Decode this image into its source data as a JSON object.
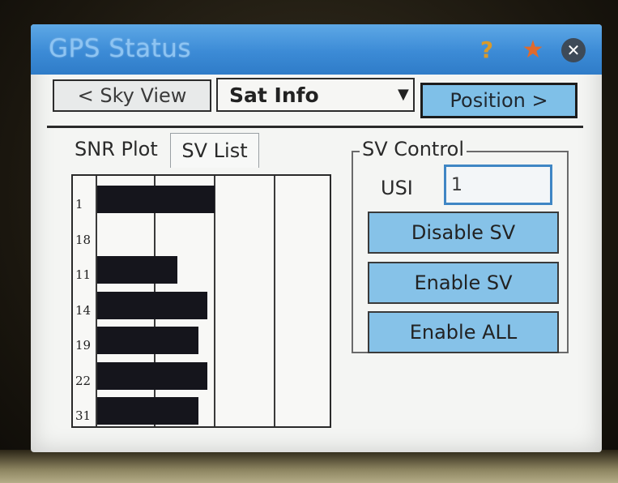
{
  "window": {
    "title": "GPS Status",
    "help_glyph": "?",
    "star_glyph": "★",
    "close_glyph": "✕"
  },
  "toolbar": {
    "back_label": "< Sky View",
    "view_select": {
      "selected": "Sat Info",
      "arrow": "▼"
    },
    "forward_label": "Position >"
  },
  "tabs": [
    {
      "label": "SNR Plot",
      "active": false
    },
    {
      "label": "SV List",
      "active": true
    }
  ],
  "snr_plot": {
    "rows": [
      {
        "sv": "1",
        "snr_fraction": 0.5
      },
      {
        "sv": "18",
        "snr_fraction": 0.0
      },
      {
        "sv": "11",
        "snr_fraction": 0.34
      },
      {
        "sv": "14",
        "snr_fraction": 0.47
      },
      {
        "sv": "19",
        "snr_fraction": 0.43
      },
      {
        "sv": "22",
        "snr_fraction": 0.47
      },
      {
        "sv": "31",
        "snr_fraction": 0.43
      }
    ]
  },
  "sv_control": {
    "title": "SV Control",
    "usi_label": "USI",
    "usi_value": "1",
    "disable_label": "Disable SV",
    "enable_label": "Enable SV",
    "enable_all_label": "Enable ALL"
  },
  "colors": {
    "titlebar": "#3c8bd6",
    "button_blue": "#86c2e8",
    "bar": "#15151c"
  }
}
